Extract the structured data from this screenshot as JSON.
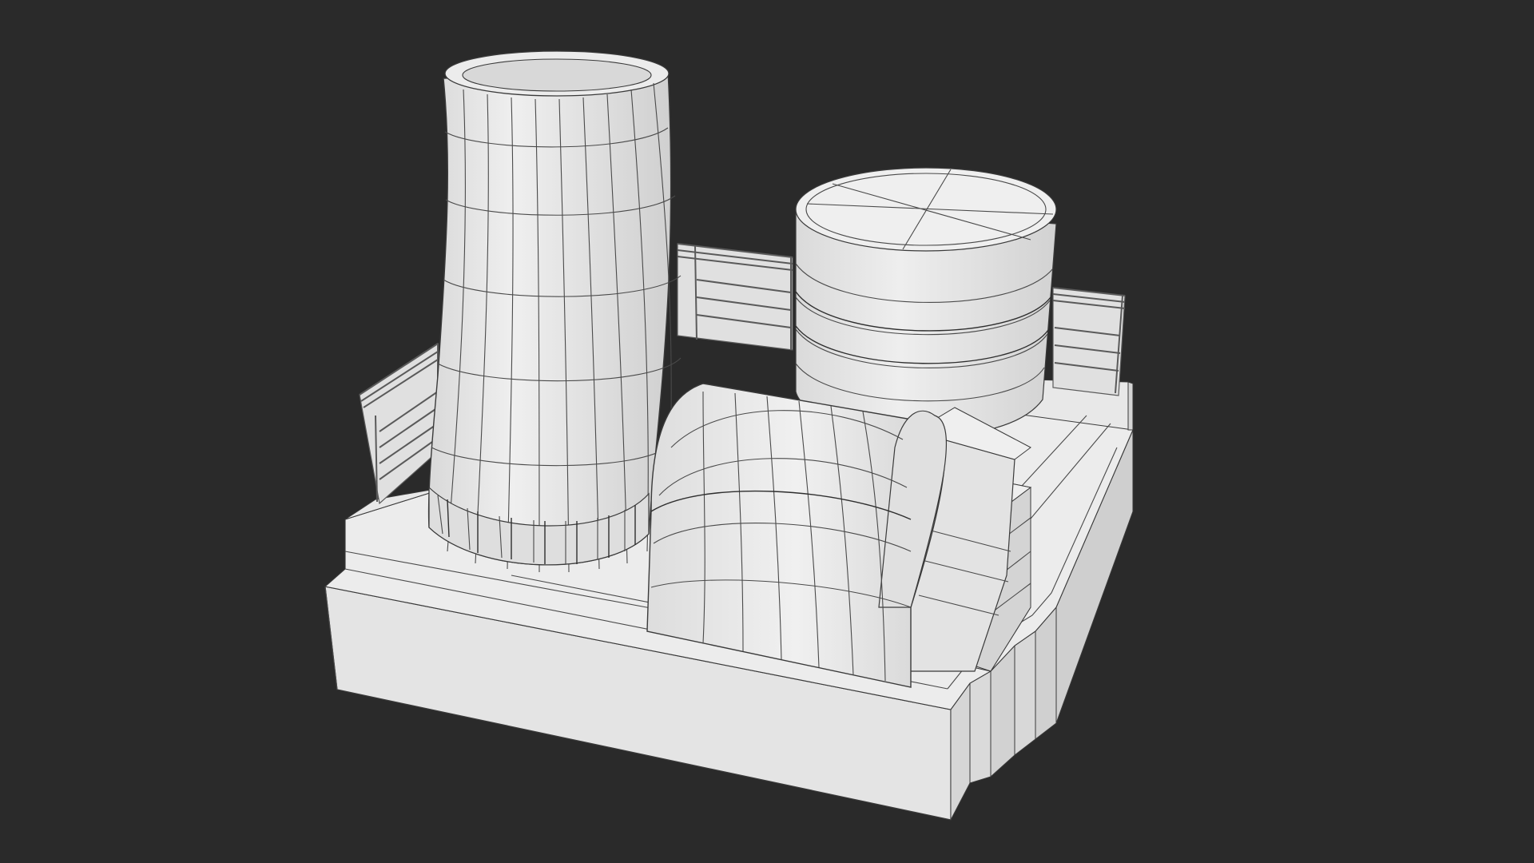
{
  "scene": {
    "background": "#2a2a2a",
    "model_color": "#e6e6e6",
    "wire_color": "#4a4a4a",
    "render_style": "clay render with wireframe overlay",
    "subject": "power plant",
    "parts": [
      "cooling-tower",
      "cylindrical-tank",
      "vaulted-hall",
      "raised-platform",
      "terraced-base",
      "safety-railings"
    ]
  }
}
